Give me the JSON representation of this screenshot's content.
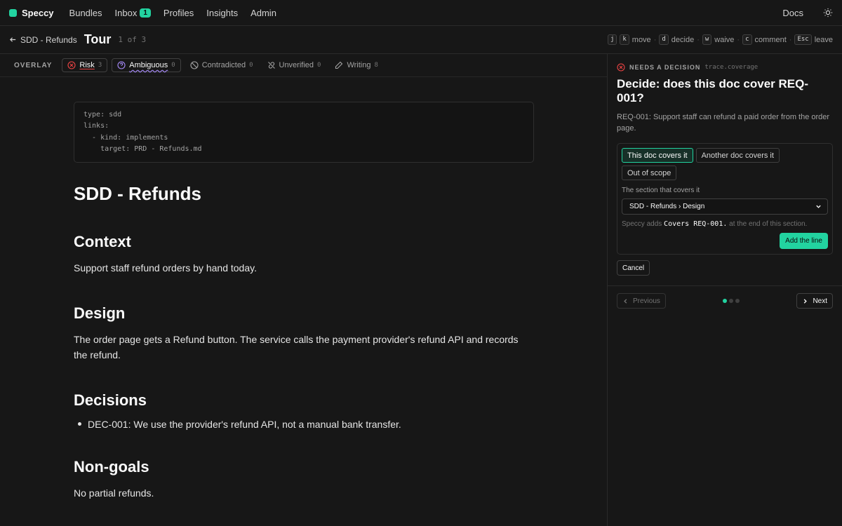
{
  "nav": {
    "brand": "Speccy",
    "items": [
      {
        "label": "Bundles"
      },
      {
        "label": "Inbox",
        "badge": "1"
      },
      {
        "label": "Profiles"
      },
      {
        "label": "Insights"
      },
      {
        "label": "Admin"
      }
    ],
    "docs": "Docs",
    "theme_icon": "sun-icon"
  },
  "tourbar": {
    "back_label": "SDD - Refunds",
    "title": "Tour",
    "count": "1 of 3",
    "shortcuts": [
      {
        "key": "j",
        "label": ""
      },
      {
        "key": "k",
        "label": "move"
      },
      {
        "key": "d",
        "label": "decide"
      },
      {
        "key": "w",
        "label": "waive"
      },
      {
        "key": "c",
        "label": "comment"
      },
      {
        "key": "Esc",
        "label": "leave"
      }
    ]
  },
  "overlay": {
    "label": "OVERLAY",
    "chips": [
      {
        "label": "Risk",
        "count": "3"
      },
      {
        "label": "Ambiguous",
        "count": "0"
      },
      {
        "label": "Contradicted",
        "count": "0"
      },
      {
        "label": "Unverified",
        "count": "0"
      },
      {
        "label": "Writing",
        "count": "8"
      }
    ]
  },
  "doc": {
    "frontmatter": "type: sdd\nlinks:\n  - kind: implements\n    target: PRD - Refunds.md",
    "title": "SDD - Refunds",
    "sections": {
      "context_heading": "Context",
      "context_text": "Support staff refund orders by hand today.",
      "design_heading": "Design",
      "design_text": "The order page gets a Refund button. The service calls the payment provider's refund API and records the refund.",
      "decisions_heading": "Decisions",
      "decisions_item": "DEC-001: We use the provider's refund API, not a manual bank transfer.",
      "nongoals_heading": "Non-goals",
      "nongoals_text": "No partial refunds."
    }
  },
  "panel": {
    "needs_label": "NEEDS A DECISION",
    "needs_tag": "trace.coverage",
    "title": "Decide: does this doc cover REQ-001?",
    "requirement": "REQ-001: Support staff can refund a paid order from the order page.",
    "options": [
      "This doc covers it",
      "Another doc covers it",
      "Out of scope"
    ],
    "selected_option": "This doc covers it",
    "section_label": "The section that covers it",
    "section_value": "SDD - Refunds › Design",
    "adds_prefix": "Speccy adds",
    "adds_code": "Covers REQ-001.",
    "adds_suffix": "at the end of this section.",
    "add_button": "Add the line",
    "cancel": "Cancel",
    "prev": "Previous",
    "next": "Next",
    "step_current": 1,
    "step_total": 3
  },
  "colors": {
    "accent": "#22d3a0",
    "risk": "#ef4444",
    "ambiguous": "#a78bfa"
  }
}
